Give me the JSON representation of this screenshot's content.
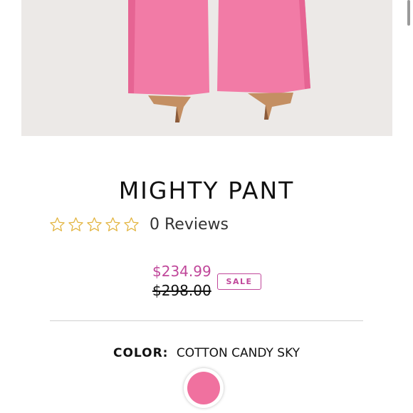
{
  "product": {
    "title": "MIGHTY PANT",
    "rating": {
      "stars_filled": 0,
      "stars_total": 5,
      "reviews_text": "0 Reviews"
    },
    "price": {
      "sale": "$234.99",
      "original": "$298.00",
      "badge": "SALE"
    },
    "color": {
      "label": "COLOR:",
      "value": "COTTON CANDY SKY",
      "swatch_hex": "#f0719f"
    }
  },
  "theme": {
    "accent": "#c0479a",
    "star_color": "#e2b33c",
    "pant_color": "#f27ba6"
  }
}
